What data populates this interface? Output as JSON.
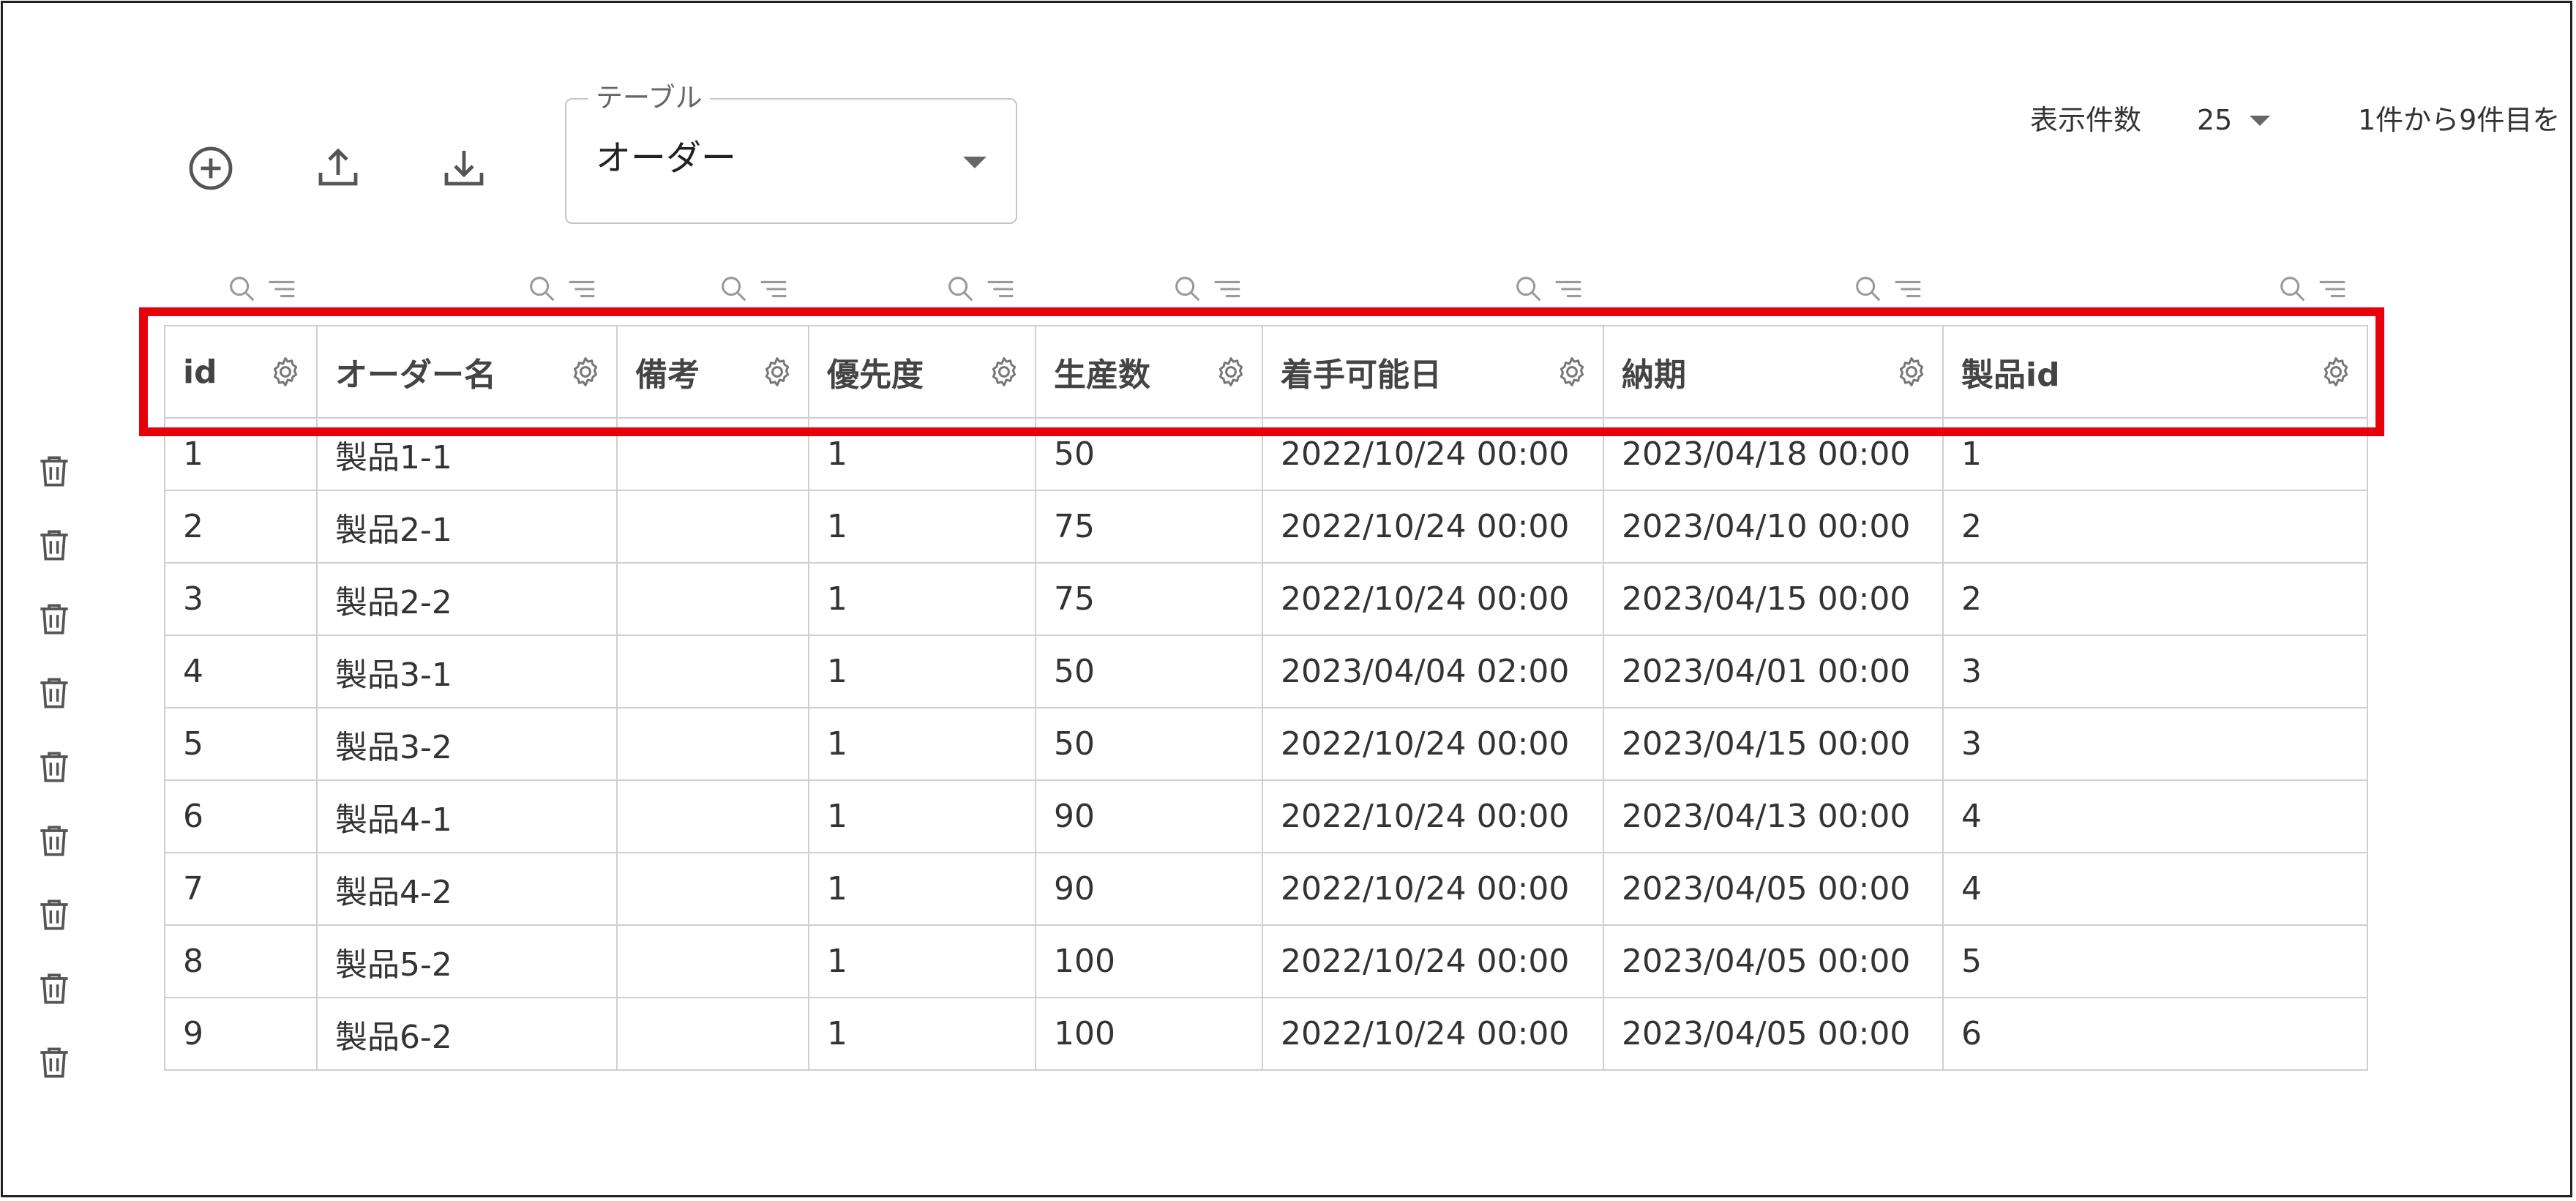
{
  "toolbar": {
    "icons": [
      "add-circle-icon",
      "upload-icon",
      "download-icon"
    ]
  },
  "table_select": {
    "legend": "テーブル",
    "value": "オーダー"
  },
  "pagination": {
    "page_size_label": "表示件数",
    "page_size_value": "25",
    "range_text": "1件から9件目を"
  },
  "columns": [
    {
      "label": "id"
    },
    {
      "label": "オーダー名"
    },
    {
      "label": "備考"
    },
    {
      "label": "優先度"
    },
    {
      "label": "生産数"
    },
    {
      "label": "着手可能日"
    },
    {
      "label": "納期"
    },
    {
      "label": "製品id"
    }
  ],
  "rows": [
    [
      "1",
      "製品1-1",
      "",
      "1",
      "50",
      "2022/10/24 00:00",
      "2023/04/18 00:00",
      "1"
    ],
    [
      "2",
      "製品2-1",
      "",
      "1",
      "75",
      "2022/10/24 00:00",
      "2023/04/10 00:00",
      "2"
    ],
    [
      "3",
      "製品2-2",
      "",
      "1",
      "75",
      "2022/10/24 00:00",
      "2023/04/15 00:00",
      "2"
    ],
    [
      "4",
      "製品3-1",
      "",
      "1",
      "50",
      "2023/04/04 02:00",
      "2023/04/01 00:00",
      "3"
    ],
    [
      "5",
      "製品3-2",
      "",
      "1",
      "50",
      "2022/10/24 00:00",
      "2023/04/15 00:00",
      "3"
    ],
    [
      "6",
      "製品4-1",
      "",
      "1",
      "90",
      "2022/10/24 00:00",
      "2023/04/13 00:00",
      "4"
    ],
    [
      "7",
      "製品4-2",
      "",
      "1",
      "90",
      "2022/10/24 00:00",
      "2023/04/05 00:00",
      "4"
    ],
    [
      "8",
      "製品5-2",
      "",
      "1",
      "100",
      "2022/10/24 00:00",
      "2023/04/05 00:00",
      "5"
    ],
    [
      "9",
      "製品6-2",
      "",
      "1",
      "100",
      "2022/10/24 00:00",
      "2023/04/05 00:00",
      "6"
    ]
  ],
  "colors": {
    "highlight": "#e8000b",
    "border": "#cfcfcf",
    "icon": "#555555"
  }
}
